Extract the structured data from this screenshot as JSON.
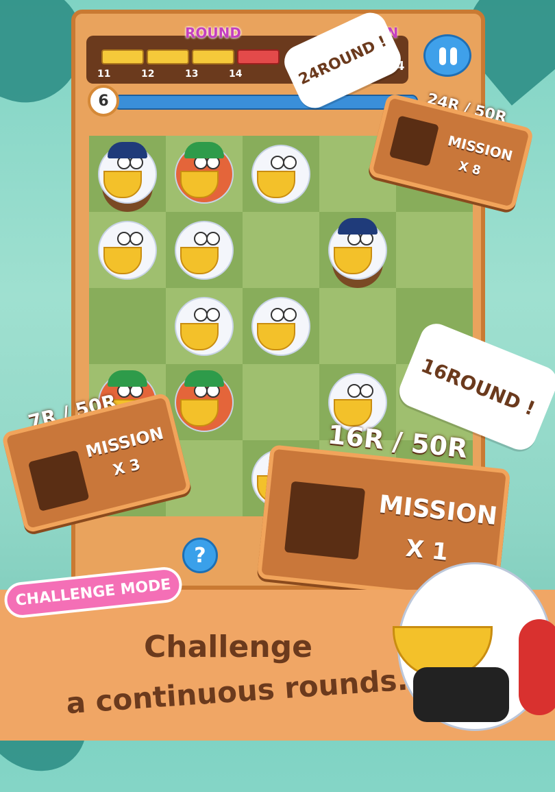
{
  "hud": {
    "round_label": "ROUND",
    "mission_label": "ION",
    "round_ticks": [
      "11",
      "12",
      "13",
      "14",
      "4"
    ],
    "timer_number": "6"
  },
  "board": {
    "cells": [
      [
        "bird-nest",
        "parrot",
        "bird",
        "",
        ""
      ],
      [
        "bird",
        "bird",
        "",
        "bird-nest",
        ""
      ],
      [
        "",
        "bird",
        "bird",
        "",
        ""
      ],
      [
        "parrot",
        "parrot",
        "",
        "bird",
        ""
      ],
      [
        "",
        "",
        "bird",
        "",
        ""
      ]
    ]
  },
  "callouts": {
    "bubble_24": "24ROUND !",
    "bubble_16": "16ROUND !",
    "card_top": {
      "progress": "24R / 50R",
      "title": "MISSION",
      "count": "X 8"
    },
    "card_left": {
      "progress": "7R / 50R",
      "title": "MISSION",
      "count": "X 3"
    },
    "card_big": {
      "progress": "16R / 50R",
      "title": "MISSION",
      "count": "X 1"
    }
  },
  "help_symbol": "?",
  "mode_badge": "CHALLENGE MODE",
  "tagline": {
    "line1": "Challenge",
    "line2": "a continuous rounds."
  },
  "colors": {
    "accent": "#f46fb6",
    "wood": "#c9773a",
    "board_light": "#9fbf6f",
    "board_dark": "#88ad5b"
  }
}
